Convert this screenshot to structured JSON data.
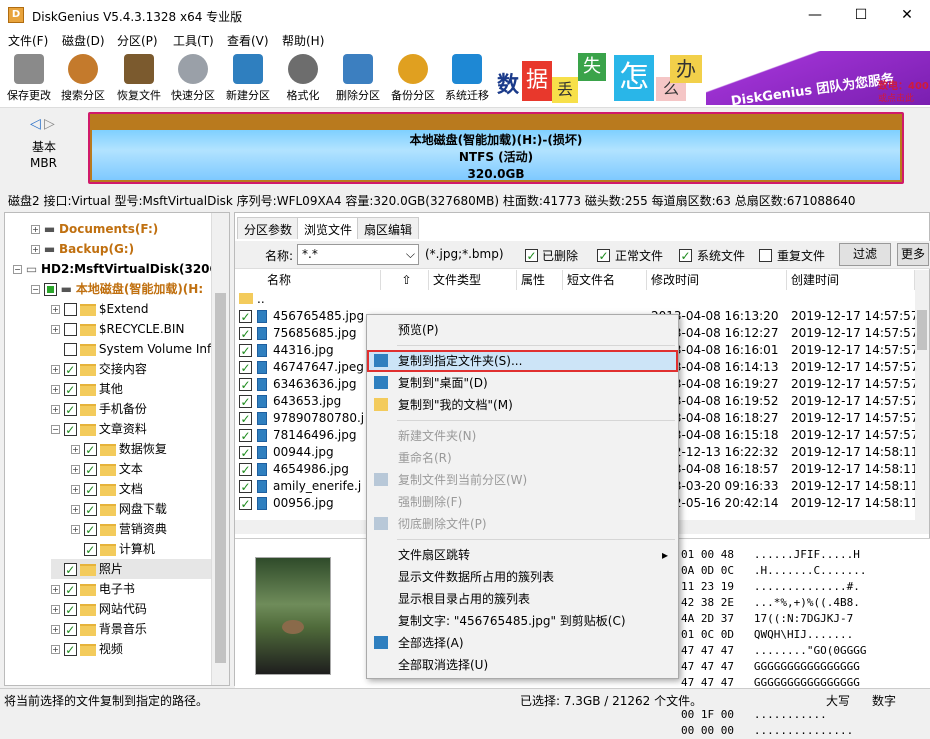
{
  "window": {
    "title": "DiskGenius V5.4.3.1328 x64 专业版",
    "icon": "diskgenius-icon",
    "minimize": "—",
    "maximize": "☐",
    "close": "✕"
  },
  "menu": [
    "文件(F)",
    "磁盘(D)",
    "分区(P)",
    "工具(T)",
    "查看(V)",
    "帮助(H)"
  ],
  "toolbar": [
    {
      "label": "保存更改",
      "icon": "save-icon",
      "color": "#8a8a8a"
    },
    {
      "label": "搜索分区",
      "icon": "magnifier-icon",
      "color": "#c47a2c"
    },
    {
      "label": "恢复文件",
      "icon": "recover-box-icon",
      "color": "#7b5a2e"
    },
    {
      "label": "快速分区",
      "icon": "quick-partition-icon",
      "color": "#9aa0a8"
    },
    {
      "label": "新建分区",
      "icon": "new-partition-icon",
      "color": "#2f7fbf"
    },
    {
      "label": "格式化",
      "icon": "format-disk-icon",
      "color": "#6d6d6d"
    },
    {
      "label": "删除分区",
      "icon": "trash-icon",
      "color": "#3c7fc0"
    },
    {
      "label": "备份分区",
      "icon": "backup-icon",
      "color": "#e0a020"
    },
    {
      "label": "系统迁移",
      "icon": "migrate-windows-icon",
      "color": "#1e88d4"
    }
  ],
  "banner": {
    "chars": [
      "数",
      "据",
      "丢",
      "失",
      "怎",
      "么",
      "办"
    ],
    "slogan": "DiskGenius 团队为您服务",
    "phone": "致电：400",
    "link": "或点击此",
    "accent": "#8a2be2"
  },
  "diskmap": {
    "nav_label_1": "基本",
    "nav_label_2": "MBR",
    "line1": "本地磁盘(智能加载)(H:)-(损坏)",
    "line2": "NTFS (活动)",
    "line3": "320.0GB"
  },
  "diskinfo": "磁盘2 接口:Virtual  型号:MsftVirtualDisk  序列号:WFL09XA4  容量:320.0GB(327680MB)  柱面数:41773  磁头数:255  每道扇区数:63  总扇区数:671088640",
  "tree": [
    {
      "label": "Documents(F:)",
      "style": "orange-bold"
    },
    {
      "label": "Backup(G:)",
      "style": "orange-bold"
    },
    {
      "label": "HD2:MsftVirtualDisk(320G",
      "style": "bold"
    },
    {
      "label": "本地磁盘(智能加载)(H:",
      "style": "orange-bold"
    },
    {
      "label": "$Extend"
    },
    {
      "label": "$RECYCLE.BIN"
    },
    {
      "label": "System Volume Inf"
    },
    {
      "label": "交接内容"
    },
    {
      "label": "其他"
    },
    {
      "label": "手机备份"
    },
    {
      "label": "文章资料"
    },
    {
      "label": "数据恢复"
    },
    {
      "label": "文本"
    },
    {
      "label": "文档"
    },
    {
      "label": "网盘下载"
    },
    {
      "label": "营销资典"
    },
    {
      "label": "计算机"
    },
    {
      "label": "照片"
    },
    {
      "label": "电子书"
    },
    {
      "label": "网站代码"
    },
    {
      "label": "背景音乐"
    },
    {
      "label": "视频"
    }
  ],
  "tabs": [
    "分区参数",
    "浏览文件",
    "扇区编辑"
  ],
  "filter": {
    "name_label": "名称:",
    "name_value": "*.*",
    "hint": "(*.jpg;*.bmp)",
    "opts": [
      "已删除",
      "正常文件",
      "系统文件",
      "重复文件"
    ],
    "btn": "过滤",
    "more": "更多"
  },
  "columns": [
    "名称",
    "文件类型",
    "属性",
    "短文件名",
    "修改时间",
    "创建时间"
  ],
  "parent_dir": "..",
  "files": [
    {
      "name": "456765485.jpg",
      "mod": "2013-04-08 16:13:20",
      "created": "2019-12-17 14:57:57"
    },
    {
      "name": "75685685.jpg",
      "mod": "2013-04-08 16:12:27",
      "created": "2019-12-17 14:57:57"
    },
    {
      "name": "44316.jpg",
      "mod": "2013-04-08 16:16:01",
      "created": "2019-12-17 14:57:57"
    },
    {
      "name": "46747647.jpeg",
      "mod": "2013-04-08 16:14:13",
      "created": "2019-12-17 14:57:57"
    },
    {
      "name": "63463636.jpg",
      "mod": "2013-04-08 16:19:27",
      "created": "2019-12-17 14:57:57"
    },
    {
      "name": "643653.jpg",
      "mod": "2013-04-08 16:19:52",
      "created": "2019-12-17 14:57:57"
    },
    {
      "name": "97890780780.j",
      "mod": "2013-04-08 16:18:27",
      "created": "2019-12-17 14:57:57"
    },
    {
      "name": "78146496.jpg",
      "mod": "2013-04-08 16:15:18",
      "created": "2019-12-17 14:57:57"
    },
    {
      "name": "00944.jpg",
      "mod": "2012-12-13 16:22:32",
      "created": "2019-12-17 14:58:11"
    },
    {
      "name": "4654986.jpg",
      "mod": "2013-04-08 16:18:57",
      "created": "2019-12-17 14:58:11"
    },
    {
      "name": "amily_enerife.j",
      "mod": "2013-03-20 09:16:33",
      "created": "2019-12-17 14:58:11"
    },
    {
      "name": "00956.jpg",
      "mod": "2012-05-16 20:42:14",
      "created": "2019-12-17 14:58:11"
    }
  ],
  "hex": [
    {
      "bytes": "01 00 48",
      "ascii": "......JFIF.....H"
    },
    {
      "bytes": "0A 0D 0C",
      "ascii": ".H.......C......."
    },
    {
      "bytes": "11 23 19",
      "ascii": "..............#."
    },
    {
      "bytes": "42 38 2E",
      "ascii": "...*%,+)%((.4B8."
    },
    {
      "bytes": "4A 2D 37",
      "ascii": "17((:N:7DGJKJ-7"
    },
    {
      "bytes": "01 0C 0D",
      "ascii": "QWQH\\HIJ......."
    },
    {
      "bytes": "47 47 47",
      "ascii": "........\"GO(0GGGG"
    },
    {
      "bytes": "47 47 47",
      "ascii": "GGGGGGGGGGGGGGGG"
    },
    {
      "bytes": "47 47 47",
      "ascii": "GGGGGGGGGGGGGGGG"
    },
    {
      "bytes": "47 FF C0",
      "ascii": "GGGGGGGGGGGGGG.."
    },
    {
      "bytes": "00 1F 00",
      "ascii": "..........."
    },
    {
      "bytes": "00 00 00",
      "ascii": "..............."
    }
  ],
  "context_menu": [
    {
      "label": "预览(P)",
      "enabled": true,
      "icon": ""
    },
    {
      "sep": true
    },
    {
      "label": "复制到指定文件夹(S)...",
      "enabled": true,
      "icon": "copy-folder-icon",
      "highlight": true
    },
    {
      "label": "复制到\"桌面\"(D)",
      "enabled": true,
      "icon": "desktop-icon"
    },
    {
      "label": "复制到\"我的文档\"(M)",
      "enabled": true,
      "icon": "documents-folder-icon"
    },
    {
      "sep": true
    },
    {
      "label": "新建文件夹(N)",
      "enabled": false,
      "icon": ""
    },
    {
      "label": "重命名(R)",
      "enabled": false,
      "icon": ""
    },
    {
      "label": "复制文件到当前分区(W)",
      "enabled": false,
      "icon": "copy-partition-icon"
    },
    {
      "label": "强制删除(F)",
      "enabled": false,
      "icon": ""
    },
    {
      "label": "彻底删除文件(P)",
      "enabled": false,
      "icon": "shred-icon"
    },
    {
      "sep": true
    },
    {
      "label": "文件扇区跳转",
      "enabled": true,
      "icon": "",
      "submenu": true
    },
    {
      "label": "显示文件数据所占用的簇列表",
      "enabled": true,
      "icon": ""
    },
    {
      "label": "显示根目录占用的簇列表",
      "enabled": true,
      "icon": ""
    },
    {
      "label": "复制文字: \"456765485.jpg\" 到剪贴板(C)",
      "enabled": true,
      "icon": ""
    },
    {
      "label": "全部选择(A)",
      "enabled": true,
      "icon": "select-all-icon"
    },
    {
      "label": "全部取消选择(U)",
      "enabled": true,
      "icon": ""
    }
  ],
  "status": {
    "left": "将当前选择的文件复制到指定的路径。",
    "middle": "已选择: 7.3GB / 21262 个文件。",
    "caps": "大写",
    "num": "数字"
  }
}
